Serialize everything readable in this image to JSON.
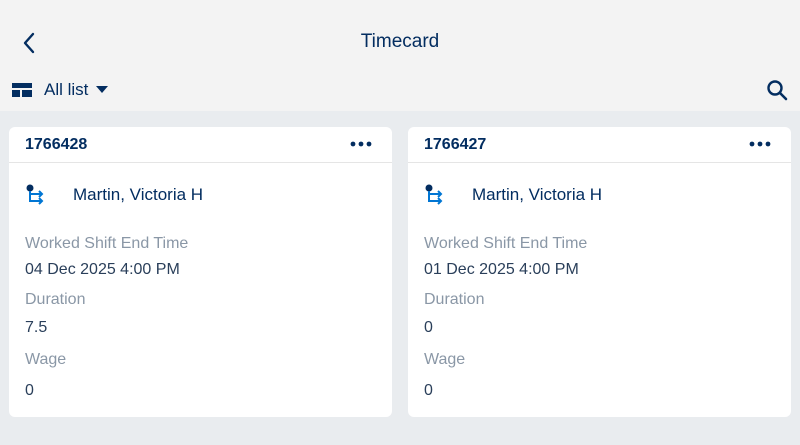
{
  "header": {
    "title": "Timecard",
    "list_view_label": "All list"
  },
  "cards": [
    {
      "id": "1766428",
      "owner": "Martin, Victoria H",
      "fields": [
        {
          "label": "Worked Shift End Time",
          "value": "04 Dec 2025 4:00 PM"
        },
        {
          "label": "Duration",
          "value": "7.5"
        },
        {
          "label": "Wage",
          "value": "0"
        }
      ]
    },
    {
      "id": "1766427",
      "owner": "Martin, Victoria H",
      "fields": [
        {
          "label": "Worked Shift End Time",
          "value": "01 Dec 2025 4:00 PM"
        },
        {
          "label": "Duration",
          "value": "0"
        },
        {
          "label": "Wage",
          "value": "0"
        }
      ]
    }
  ],
  "colors": {
    "text_primary": "#032d60",
    "label_gray": "#8a97a6",
    "accent_blue": "#0176d3",
    "background": "#e9ecef"
  },
  "icons": [
    "back-arrow-icon",
    "table-view-icon",
    "caret-down-icon",
    "search-icon",
    "more-options-icon",
    "hierarchy-icon"
  ]
}
